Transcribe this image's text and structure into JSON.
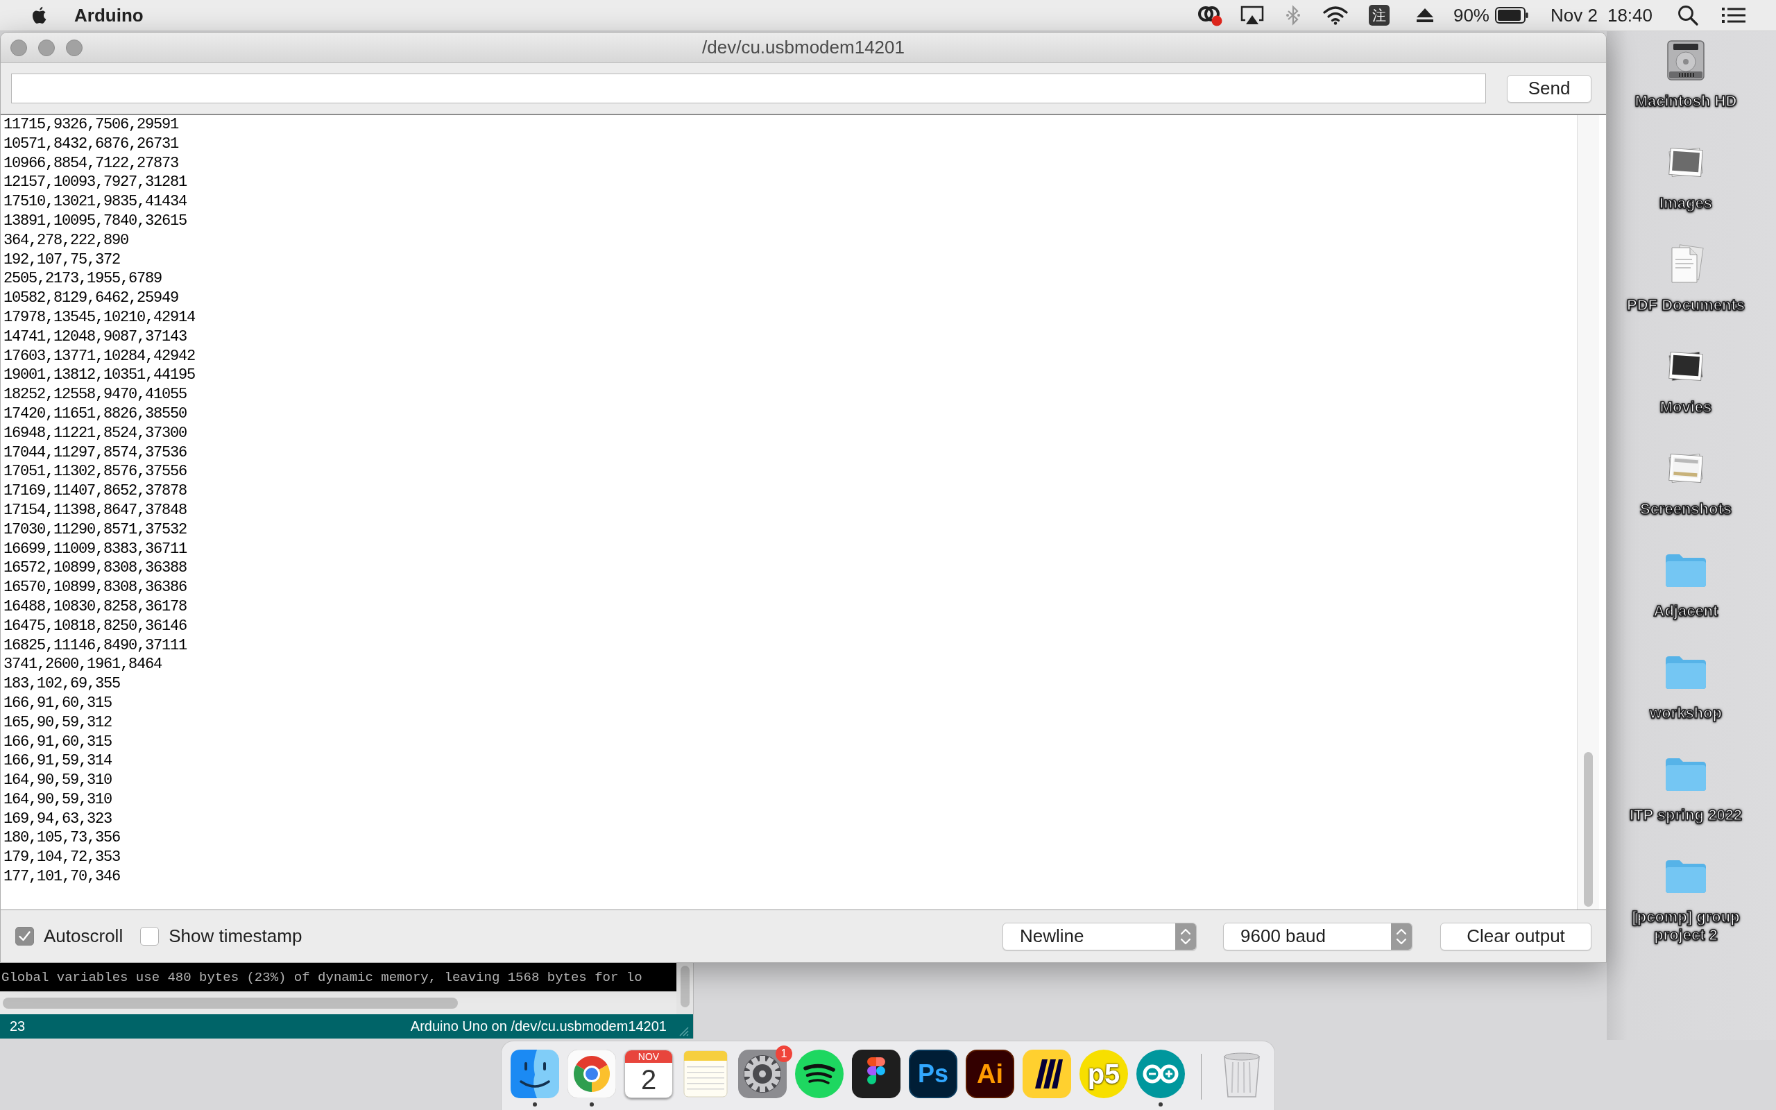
{
  "menu_bar": {
    "app_name": "Arduino",
    "status_items": [
      {
        "kind": "cloud"
      },
      {
        "kind": "airplay"
      },
      {
        "kind": "bluetooth"
      },
      {
        "kind": "wifi"
      },
      {
        "kind": "input_method",
        "text": "注"
      },
      {
        "kind": "eject"
      },
      {
        "kind": "battery",
        "text": "90%"
      },
      {
        "kind": "clock",
        "date": "Nov 2",
        "time": "18:40"
      },
      {
        "kind": "search"
      },
      {
        "kind": "list"
      }
    ]
  },
  "serial_monitor": {
    "title": "/dev/cu.usbmodem14201",
    "send_button": "Send",
    "output_lines": [
      "11715,9326,7506,29591",
      "10571,8432,6876,26731",
      "10966,8854,7122,27873",
      "12157,10093,7927,31281",
      "17510,13021,9835,41434",
      "13891,10095,7840,32615",
      "364,278,222,890",
      "192,107,75,372",
      "2505,2173,1955,6789",
      "10582,8129,6462,25949",
      "17978,13545,10210,42914",
      "14741,12048,9087,37143",
      "17603,13771,10284,42942",
      "19001,13812,10351,44195",
      "18252,12558,9470,41055",
      "17420,11651,8826,38550",
      "16948,11221,8524,37300",
      "17044,11297,8574,37536",
      "17051,11302,8576,37556",
      "17169,11407,8652,37878",
      "17154,11398,8647,37848",
      "17030,11290,8571,37532",
      "16699,11009,8383,36711",
      "16572,10899,8308,36388",
      "16570,10899,8308,36386",
      "16488,10830,8258,36178",
      "16475,10818,8250,36146",
      "16825,11146,8490,37111",
      "3741,2600,1961,8464",
      "183,102,69,355",
      "166,91,60,315",
      "165,90,59,312",
      "166,91,60,315",
      "166,91,59,314",
      "164,90,59,310",
      "164,90,59,310",
      "169,94,63,323",
      "180,105,73,356",
      "179,104,72,353",
      "177,101,70,346"
    ],
    "options": [
      {
        "label": "Autoscroll",
        "checked": true
      },
      {
        "label": "Show timestamp",
        "checked": false
      }
    ],
    "line_ending": "Newline",
    "baud_rate": "9600 baud",
    "clear_button": "Clear output"
  },
  "ide_window": {
    "console_line": "Global variables use 480 bytes (23%) of dynamic memory, leaving 1568 bytes for lo",
    "status_bar": {
      "line": "23",
      "board": "Arduino Uno on /dev/cu.usbmodem14201"
    }
  },
  "desktop_items": [
    {
      "kind": "drive",
      "label": "Macintosh HD"
    },
    {
      "kind": "image_stack",
      "label": "Images"
    },
    {
      "kind": "document_stack",
      "label": "PDF Documents"
    },
    {
      "kind": "movie_stack",
      "label": "Movies"
    },
    {
      "kind": "screenshot_stack",
      "label": "Screenshots"
    },
    {
      "kind": "folder",
      "label": "Adjacent"
    },
    {
      "kind": "folder",
      "label": "workshop"
    },
    {
      "kind": "folder",
      "label": "ITP spring 2022"
    },
    {
      "kind": "folder",
      "label": "[pcomp] group project 2"
    }
  ],
  "dock": {
    "apps": [
      {
        "kind": "finder",
        "running": true
      },
      {
        "kind": "chrome",
        "running": true
      },
      {
        "kind": "calendar",
        "month": "NOV",
        "day": "2",
        "running": false
      },
      {
        "kind": "notes",
        "running": false
      },
      {
        "kind": "system_preferences",
        "badge": "1",
        "running": false
      },
      {
        "kind": "spotify",
        "running": false
      },
      {
        "kind": "figma",
        "running": false
      },
      {
        "kind": "photoshop",
        "label": "Ps",
        "running": false
      },
      {
        "kind": "illustrator",
        "label": "Ai",
        "running": false
      },
      {
        "kind": "miro",
        "running": false
      },
      {
        "kind": "p5",
        "label": "p5",
        "running": false
      },
      {
        "kind": "arduino",
        "running": true
      }
    ]
  }
}
